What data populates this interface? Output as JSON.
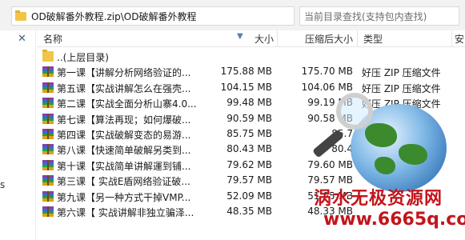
{
  "address": {
    "path": "OD破解番外教程.zip\\OD破解番外教程"
  },
  "search": {
    "placeholder": "当前目录查找(支持包内查找)"
  },
  "nav": {
    "close_glyph": "✕",
    "mark_glyph": "s"
  },
  "columns": {
    "name": "名称",
    "size": "大小",
    "compressed": "压缩后大小",
    "type": "类型",
    "extra": "安"
  },
  "parent_row": {
    "label": "..(上层目录)"
  },
  "files": [
    {
      "name": "第一课【讲解分析网络验证的...",
      "size": "175.88 MB",
      "compressed": "175.70 MB",
      "type": "好压 ZIP 压缩文件"
    },
    {
      "name": "第五课【实战讲解怎么在强壳...",
      "size": "104.15 MB",
      "compressed": "104.06 MB",
      "type": "好压 ZIP 压缩文件"
    },
    {
      "name": "第二课【实战全面分析山寨4.0...",
      "size": "99.48 MB",
      "compressed": "99.19 MB",
      "type": "好压 ZIP 压缩文件"
    },
    {
      "name": "第七课【算法再现；如何爆破...",
      "size": "90.59 MB",
      "compressed": "90.58 MB",
      "type": ""
    },
    {
      "name": "第四课【实战破解变态的易游...",
      "size": "85.75 MB",
      "compressed": "85.7",
      "type": ""
    },
    {
      "name": "第八课【快速简单破解另类到...",
      "size": "80.43 MB",
      "compressed": "80.4",
      "type": ""
    },
    {
      "name": "第十课【实战简单讲解運到铺...",
      "size": "79.62 MB",
      "compressed": "79.60 MB",
      "type": ""
    },
    {
      "name": "第三课【 实战E盾网络验证破...",
      "size": "79.57 MB",
      "compressed": "79.57 MB",
      "type": ""
    },
    {
      "name": "第九课【另一种方式干掉VMP...",
      "size": "52.09 MB",
      "compressed": "51.95 MB",
      "type": ""
    },
    {
      "name": "第六课【 实战讲解非独立骗泽...",
      "size": "48.35 MB",
      "compressed": "48.33 MB",
      "type": ""
    }
  ],
  "watermark": {
    "line1": "涡水无极资源网",
    "line2": "www.6665q.com"
  },
  "colors": {
    "watermark": "#c4141b",
    "accent": "#2f6fd0"
  }
}
